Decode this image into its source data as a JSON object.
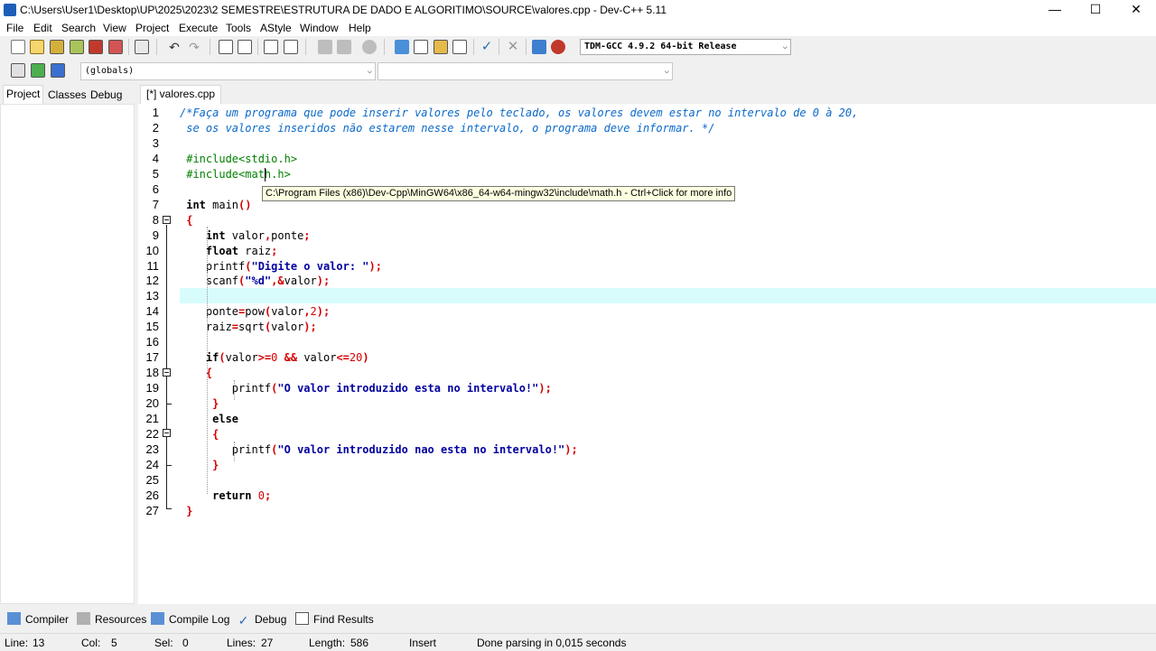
{
  "window": {
    "title": "C:\\Users\\User1\\Desktop\\UP\\2025\\2023\\2 SEMESTRE\\ESTRUTURA DE DADO E ALGORITIMO\\SOURCE\\valores.cpp - Dev-C++ 5.11",
    "minimize": "—",
    "maximize": "☐",
    "close": "✕"
  },
  "menu": [
    "File",
    "Edit",
    "Search",
    "View",
    "Project",
    "Execute",
    "Tools",
    "AStyle",
    "Window",
    "Help"
  ],
  "toolbar": {
    "compiler": "TDM-GCC 4.9.2 64-bit Release",
    "scope": "(globals)",
    "symbol": ""
  },
  "left_tabs": [
    "Project",
    "Classes",
    "Debug"
  ],
  "editor_tab": "[*] valores.cpp",
  "code": {
    "line_numbers": [
      "1",
      "2",
      "3",
      "4",
      "5",
      "6",
      "7",
      "8",
      "9",
      "10",
      "11",
      "12",
      "13",
      "14",
      "15",
      "16",
      "17",
      "18",
      "19",
      "20",
      "21",
      "22",
      "23",
      "24",
      "25",
      "26",
      "27"
    ],
    "lines": [
      [
        [
          "cm",
          "/*Faça um programa que pode inserir valores pelo teclado, os valores devem estar no intervalo de 0 à 20,"
        ]
      ],
      [
        [
          "cm",
          " se os valores inseridos não estarem nesse intervalo, o programa deve informar. */"
        ]
      ],
      [],
      [
        [
          "pp",
          " #include<stdio.h>"
        ]
      ],
      [
        [
          "pp",
          " #include<math.h>"
        ]
      ],
      [],
      [
        [
          "kw",
          " int"
        ],
        [
          "id",
          " main"
        ],
        [
          "sym",
          "()"
        ]
      ],
      [
        [
          "sym",
          " {"
        ]
      ],
      [
        [
          "kw",
          "    int"
        ],
        [
          "id",
          " valor"
        ],
        [
          "sym",
          ","
        ],
        [
          "id",
          "ponte"
        ],
        [
          "sym",
          ";"
        ]
      ],
      [
        [
          "kw",
          "    float"
        ],
        [
          "id",
          " raiz"
        ],
        [
          "sym",
          ";"
        ]
      ],
      [
        [
          "id",
          "    printf"
        ],
        [
          "sym",
          "("
        ],
        [
          "str",
          "\"Digite o valor: \""
        ],
        [
          "sym",
          ");"
        ]
      ],
      [
        [
          "id",
          "    scanf"
        ],
        [
          "sym",
          "("
        ],
        [
          "str",
          "\"%d\""
        ],
        [
          "sym",
          ",&"
        ],
        [
          "id",
          "valor"
        ],
        [
          "sym",
          ");"
        ]
      ],
      [],
      [
        [
          "id",
          "    ponte"
        ],
        [
          "sym",
          "="
        ],
        [
          "id",
          "pow"
        ],
        [
          "sym",
          "("
        ],
        [
          "id",
          "valor"
        ],
        [
          "sym",
          ","
        ],
        [
          "num",
          "2"
        ],
        [
          "sym",
          ");"
        ]
      ],
      [
        [
          "id",
          "    raiz"
        ],
        [
          "sym",
          "="
        ],
        [
          "id",
          "sqrt"
        ],
        [
          "sym",
          "("
        ],
        [
          "id",
          "valor"
        ],
        [
          "sym",
          ");"
        ]
      ],
      [],
      [
        [
          "kw",
          "    if"
        ],
        [
          "sym",
          "("
        ],
        [
          "id",
          "valor"
        ],
        [
          "sym",
          ">="
        ],
        [
          "num",
          "0"
        ],
        [
          "sym",
          " && "
        ],
        [
          "id",
          "valor"
        ],
        [
          "sym",
          "<="
        ],
        [
          "num",
          "20"
        ],
        [
          "sym",
          ")"
        ]
      ],
      [
        [
          "sym",
          "    {"
        ]
      ],
      [
        [
          "id",
          "        printf"
        ],
        [
          "sym",
          "("
        ],
        [
          "str",
          "\"O valor introduzido esta no intervalo!\""
        ],
        [
          "sym",
          ");"
        ]
      ],
      [
        [
          "sym",
          "     }"
        ]
      ],
      [
        [
          "kw",
          "     else"
        ]
      ],
      [
        [
          "sym",
          "     {"
        ]
      ],
      [
        [
          "id",
          "        printf"
        ],
        [
          "sym",
          "("
        ],
        [
          "str",
          "\"O valor introduzido nao esta no intervalo!\""
        ],
        [
          "sym",
          ");"
        ]
      ],
      [
        [
          "sym",
          "     }"
        ]
      ],
      [],
      [
        [
          "kw",
          "     return"
        ],
        [
          "num",
          " 0"
        ],
        [
          "sym",
          ";"
        ]
      ],
      [
        [
          "sym",
          " }"
        ]
      ]
    ]
  },
  "tooltip": "C:\\Program Files (x86)\\Dev-Cpp\\MinGW64\\x86_64-w64-mingw32\\include\\math.h - Ctrl+Click for more info",
  "bottom_tabs": [
    "Compiler",
    "Resources",
    "Compile Log",
    "Debug",
    "Find Results"
  ],
  "status": {
    "line_label": "Line:",
    "line": "13",
    "col_label": "Col:",
    "col": "5",
    "sel_label": "Sel:",
    "sel": "0",
    "lines_label": "Lines:",
    "lines": "27",
    "length_label": "Length:",
    "length": "586",
    "mode": "Insert",
    "message": "Done parsing in 0,015 seconds"
  },
  "colors": {
    "comment": "#0a69c9",
    "preprocessor": "#008000",
    "symbol": "#d40000",
    "string": "#0000a0",
    "current_line": "#d8fcfc",
    "tooltip_bg": "#ffffe1"
  }
}
